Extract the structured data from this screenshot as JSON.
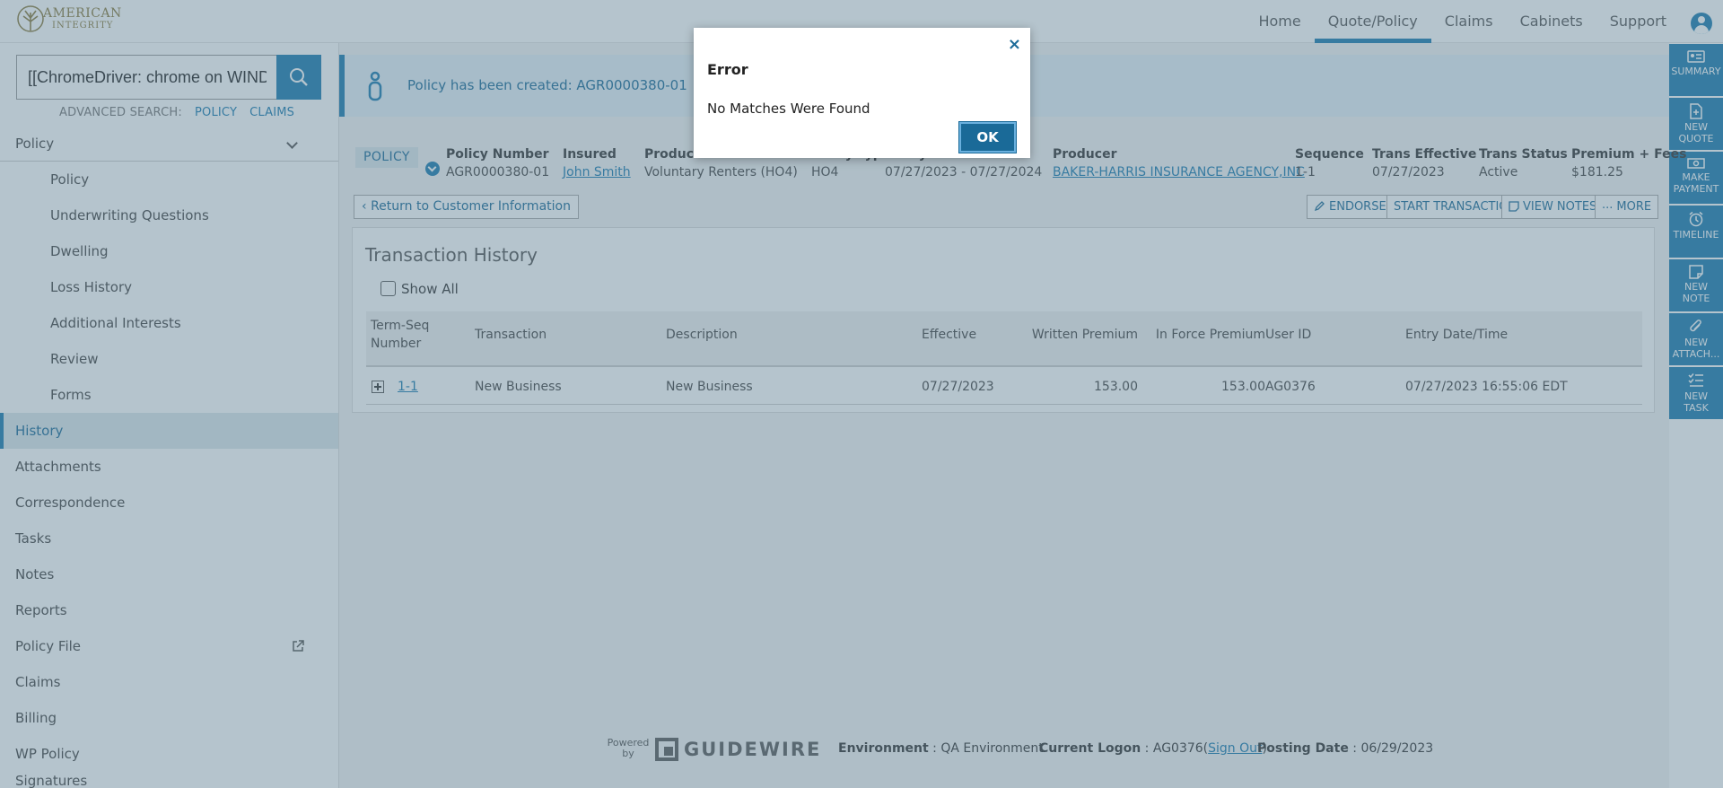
{
  "brand": {
    "logo_line1": "AMERICAN",
    "logo_line2": "INTEGRITY"
  },
  "nav": {
    "items": [
      "Home",
      "Quote/Policy",
      "Claims",
      "Cabinets",
      "Support"
    ],
    "active": "Quote/Policy"
  },
  "search": {
    "value": "[[ChromeDriver: chrome on WIND",
    "advanced_label": "ADVANCED SEARCH:",
    "policy_link": "POLICY",
    "claims_link": "CLAIMS"
  },
  "sidebar": {
    "policy_group": "Policy",
    "sub_items": [
      "Policy",
      "Underwriting Questions",
      "Dwelling",
      "Loss History",
      "Additional Interests",
      "Review",
      "Forms"
    ],
    "items": [
      "History",
      "Attachments",
      "Correspondence",
      "Tasks",
      "Notes",
      "Reports",
      "Policy File",
      "Claims",
      "Billing",
      "WP Policy",
      "Signatures"
    ],
    "selected": "History"
  },
  "rightbar": {
    "items": [
      {
        "l1": "SUMMARY",
        "l2": "",
        "icon": "id-card-icon"
      },
      {
        "l1": "NEW",
        "l2": "QUOTE",
        "icon": "new-document-icon"
      },
      {
        "l1": "MAKE",
        "l2": "PAYMENT",
        "icon": "money-icon"
      },
      {
        "l1": "TIMELINE",
        "l2": "",
        "icon": "alarm-clock-icon"
      },
      {
        "l1": "NEW",
        "l2": "NOTE",
        "icon": "note-icon"
      },
      {
        "l1": "NEW",
        "l2": "ATTACH...",
        "icon": "paperclip-icon"
      },
      {
        "l1": "NEW",
        "l2": "TASK",
        "icon": "task-list-icon"
      }
    ]
  },
  "banner": {
    "message": "Policy has been created: AGR0000380-01"
  },
  "policy_bar": {
    "tag": "POLICY",
    "policy_number_label": "Policy Number",
    "policy_number": "AGR0000380-01",
    "insured_label": "Insured",
    "insured": "John Smith",
    "product_label": "Product",
    "product": "Voluntary Renters (HO4)",
    "type_label": "Policy Type",
    "type": "HO4",
    "term_label": "Policy Term",
    "term": "07/27/2023 - 07/27/2024",
    "producer_label": "Producer",
    "producer": "BAKER-HARRIS INSURANCE AGENCY,INC",
    "sequence_label": "Sequence",
    "sequence": "1-1",
    "trans_effective_label": "Trans Effective",
    "trans_effective": "07/27/2023",
    "trans_status_label": "Trans Status",
    "trans_status": "Active",
    "premium_label": "Premium + Fees",
    "premium": "$181.25"
  },
  "actions": {
    "back": "Return to Customer Information",
    "endorse": "ENDORSE",
    "start_transaction": "START TRANSACTION",
    "view_notes": "VIEW NOTES",
    "more": "MORE"
  },
  "history": {
    "title": "Transaction History",
    "show_all": "Show All",
    "columns": [
      "Term-Seq Number",
      "Transaction",
      "Description",
      "Effective",
      "Written Premium",
      "In Force Premium",
      "User ID",
      "Entry Date/Time"
    ],
    "rows": [
      [
        "1-1",
        "New Business",
        "New Business",
        "07/27/2023",
        "153.00",
        "153.00",
        "AG0376",
        "07/27/2023 16:55:06 EDT"
      ]
    ]
  },
  "footer": {
    "powered_by": "Powered by",
    "vendor": "GUIDEWIRE",
    "environment_label": "Environment",
    "environment": "QA Environment",
    "logon_label": "Current Logon",
    "logon_user": "AG0376",
    "sign_out": "Sign Out",
    "posting_label": "Posting Date",
    "posting_date": "06/29/2023"
  },
  "dialog": {
    "title": "Error",
    "message": "No Matches Were Found",
    "ok": "OK",
    "close": "×"
  }
}
